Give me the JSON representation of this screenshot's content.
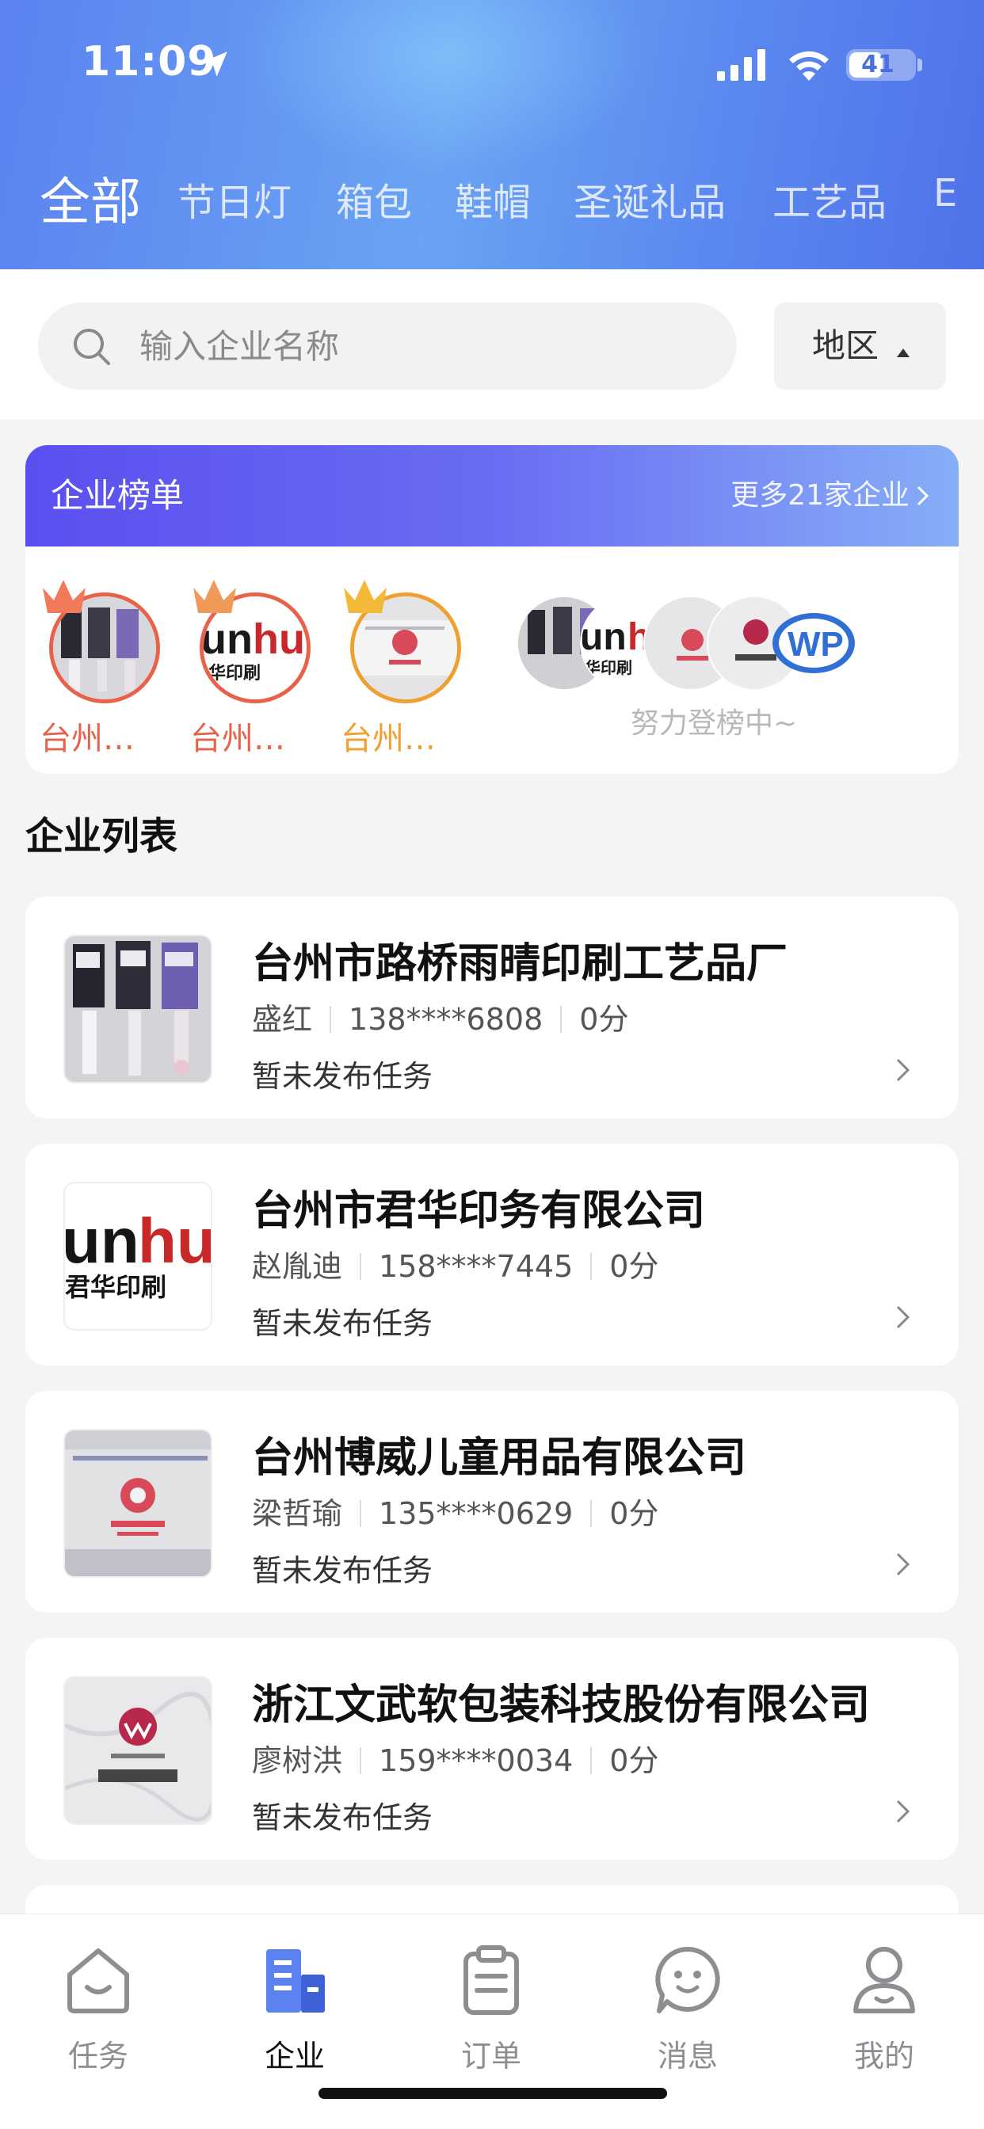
{
  "status_bar": {
    "time": "11:09",
    "battery": "41"
  },
  "categories": {
    "tabs": [
      "全部",
      "节日灯",
      "箱包",
      "鞋帽",
      "圣诞礼品",
      "工艺品",
      "E"
    ],
    "active_index": 0
  },
  "search": {
    "placeholder": "输入企业名称",
    "region_label": "地区"
  },
  "ranking": {
    "title": "企业榜单",
    "more": "更多21家企业",
    "top": [
      {
        "name": "台州…",
        "color": "#e8624a",
        "crown": "#f07a5a"
      },
      {
        "name": "台州…",
        "color": "#e8624a",
        "crown": "#f09a5a"
      },
      {
        "name": "台州…",
        "color": "#f0a030",
        "crown": "#f5b93a"
      }
    ],
    "waiting_text": "努力登榜中~"
  },
  "list": {
    "title": "企业列表",
    "companies": [
      {
        "name": "台州市路桥雨晴印刷工艺品厂",
        "contact": "盛红",
        "phone": "138****6808",
        "score": "0分",
        "status": "暂未发布任务",
        "thumb": "bottles"
      },
      {
        "name": "台州市君华印务有限公司",
        "contact": "赵胤迪",
        "phone": "158****7445",
        "score": "0分",
        "status": "暂未发布任务",
        "thumb": "junhua-logo"
      },
      {
        "name": "台州博威儿童用品有限公司",
        "contact": "梁哲瑜",
        "phone": "135****0629",
        "score": "0分",
        "status": "暂未发布任务",
        "thumb": "bowei-sign"
      },
      {
        "name": "浙江文武软包装科技股份有限公司",
        "contact": "廖树洪",
        "phone": "159****0034",
        "score": "0分",
        "status": "暂未发布任务",
        "thumb": "wenwu-logo"
      }
    ]
  },
  "bottom_nav": {
    "items": [
      {
        "label": "任务",
        "icon": "task-icon"
      },
      {
        "label": "企业",
        "icon": "enterprise-icon"
      },
      {
        "label": "订单",
        "icon": "order-icon"
      },
      {
        "label": "消息",
        "icon": "message-icon"
      },
      {
        "label": "我的",
        "icon": "profile-icon"
      }
    ],
    "active_index": 1
  },
  "colors": {
    "primary": "#4b6ff0",
    "rank_gradient_start": "#5a4ff0",
    "rank_gradient_end": "#86aef7",
    "rank_first": "#e8624a",
    "rank_third": "#f0a030"
  }
}
